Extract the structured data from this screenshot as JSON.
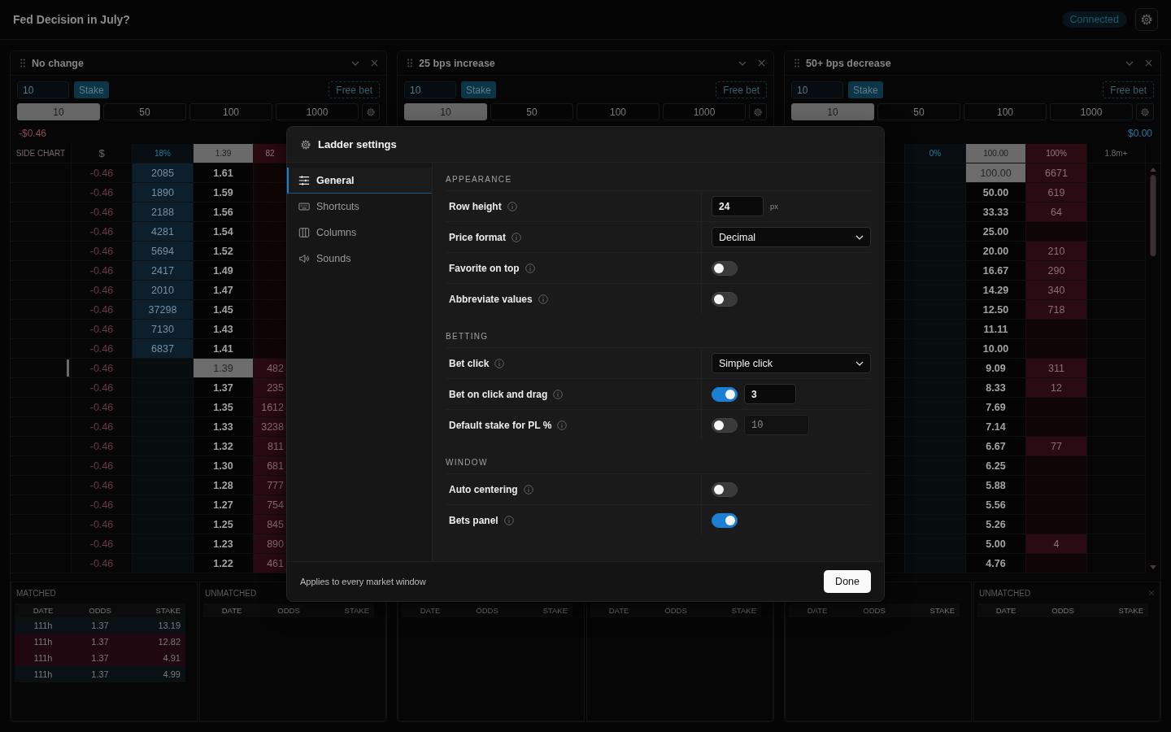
{
  "topbar": {
    "title": "Fed Decision in July?",
    "status": "Connected"
  },
  "ladders": [
    {
      "title": "No change",
      "stake_value": "10",
      "stake_button": "Stake",
      "free_bet_button": "Free bet",
      "presets": [
        {
          "label": "10",
          "selected": true
        },
        {
          "label": "50",
          "selected": false
        },
        {
          "label": "100",
          "selected": false
        },
        {
          "label": "1000",
          "selected": false
        }
      ],
      "pl": {
        "text": "-$0.46",
        "color": "#8a4a55"
      },
      "ladder_columns": [
        {
          "kind": "side",
          "label": "SIDE CHART"
        },
        {
          "kind": "pl",
          "label": "$"
        },
        {
          "kind": "back",
          "label": "18%"
        },
        {
          "kind": "price",
          "label": "1.39"
        },
        {
          "kind": "lay",
          "label": "82"
        }
      ],
      "rows": [
        {
          "pl": "-0.46",
          "back": "2085",
          "price": "1.61",
          "current": false
        },
        {
          "pl": "-0.46",
          "back": "1890",
          "price": "1.59",
          "current": false
        },
        {
          "pl": "-0.46",
          "back": "2188",
          "price": "1.56",
          "current": false
        },
        {
          "pl": "-0.46",
          "back": "4281",
          "price": "1.54",
          "current": false
        },
        {
          "pl": "-0.46",
          "back": "5694",
          "price": "1.52",
          "current": false
        },
        {
          "pl": "-0.46",
          "back": "2417",
          "price": "1.49",
          "current": false
        },
        {
          "pl": "-0.46",
          "back": "2010",
          "price": "1.47",
          "current": false
        },
        {
          "pl": "-0.46",
          "back": "37298",
          "price": "1.45",
          "current": false
        },
        {
          "pl": "-0.46",
          "back": "7130",
          "price": "1.43",
          "current": false
        },
        {
          "pl": "-0.46",
          "back": "6837",
          "price": "1.41",
          "current": false
        },
        {
          "pl": "-0.46",
          "price": "1.39",
          "lay": "482",
          "current": true
        },
        {
          "pl": "-0.46",
          "price": "1.37",
          "lay": "235",
          "current": false
        },
        {
          "pl": "-0.46",
          "price": "1.35",
          "lay": "1612",
          "current": false
        },
        {
          "pl": "-0.46",
          "price": "1.33",
          "lay": "3238",
          "current": false
        },
        {
          "pl": "-0.46",
          "price": "1.32",
          "lay": "811",
          "current": false
        },
        {
          "pl": "-0.46",
          "price": "1.30",
          "lay": "681",
          "current": false
        },
        {
          "pl": "-0.46",
          "price": "1.28",
          "lay": "777",
          "current": false
        },
        {
          "pl": "-0.46",
          "price": "1.27",
          "lay": "754",
          "current": false
        },
        {
          "pl": "-0.46",
          "price": "1.25",
          "lay": "845",
          "current": false
        },
        {
          "pl": "-0.46",
          "price": "1.23",
          "lay": "890",
          "current": false
        },
        {
          "pl": "-0.46",
          "price": "1.22",
          "lay": "461",
          "current": false
        }
      ],
      "bets": [
        {
          "label": "MATCHED",
          "columns": [
            "DATE",
            "ODDS",
            "STAKE"
          ],
          "rows": [
            {
              "color": "#0a1114",
              "cells": [
                "111h",
                "1.37",
                "13.19"
              ]
            },
            {
              "color": "#1f0810",
              "cells": [
                "111h",
                "1.37",
                "12.82"
              ]
            },
            {
              "color": "#1f0810",
              "cells": [
                "111h",
                "1.37",
                "4.91"
              ]
            },
            {
              "color": "#0a1114",
              "cells": [
                "111h",
                "1.37",
                "4.99"
              ]
            }
          ]
        },
        {
          "label": "UNMATCHED",
          "columns": [
            "DATE",
            "ODDS",
            "STAKE"
          ]
        }
      ]
    },
    {
      "title": "25 bps increase",
      "stake_value": "10",
      "stake_button": "Stake",
      "free_bet_button": "Free bet",
      "presets": [
        {
          "label": "10",
          "selected": true
        },
        {
          "label": "50",
          "selected": false
        },
        {
          "label": "100",
          "selected": false
        },
        {
          "label": "1000",
          "selected": false
        }
      ],
      "bets": [
        {
          "columns": [
            "DATE",
            "ODDS",
            "STAKE"
          ]
        },
        {
          "columns": [
            "DATE",
            "ODDS",
            "STAKE"
          ]
        }
      ]
    },
    {
      "title": "50+ bps decrease",
      "stake_value": "10",
      "stake_button": "Stake",
      "free_bet_button": "Free bet",
      "presets": [
        {
          "label": "10",
          "selected": true
        },
        {
          "label": "50",
          "selected": false
        },
        {
          "label": "100",
          "selected": false
        },
        {
          "label": "1000",
          "selected": false
        }
      ],
      "pl": {
        "text": "$0.00",
        "color": "#2a7aa0"
      },
      "ladder_columns": [
        {
          "kind": "pl"
        },
        {
          "kind": "back",
          "label": "0%"
        },
        {
          "kind": "price",
          "label": "100.00"
        },
        {
          "kind": "lay",
          "label": "100%"
        },
        {
          "kind": "volume",
          "label": "1.8m+"
        }
      ],
      "rows": [
        {
          "price": "100.00",
          "lay": "6671",
          "current": true
        },
        {
          "price": "50.00",
          "lay": "619",
          "current": false
        },
        {
          "price": "33.33",
          "lay": "64",
          "current": false
        },
        {
          "price": "25.00",
          "current": false
        },
        {
          "price": "20.00",
          "lay": "210",
          "current": false
        },
        {
          "price": "16.67",
          "lay": "290",
          "current": false
        },
        {
          "price": "14.29",
          "lay": "340",
          "current": false
        },
        {
          "price": "12.50",
          "lay": "718",
          "current": false
        },
        {
          "price": "11.11",
          "current": false
        },
        {
          "price": "10.00",
          "current": false
        },
        {
          "price": "9.09",
          "lay": "311",
          "current": false
        },
        {
          "price": "8.33",
          "lay": "12",
          "current": false
        },
        {
          "price": "7.69",
          "current": false
        },
        {
          "price": "7.14",
          "current": false
        },
        {
          "price": "6.67",
          "lay": "77",
          "current": false
        },
        {
          "price": "6.25",
          "current": false
        },
        {
          "price": "5.88",
          "current": false
        },
        {
          "price": "5.56",
          "current": false
        },
        {
          "price": "5.26",
          "current": false
        },
        {
          "price": "5.00",
          "lay": "4",
          "current": false
        },
        {
          "price": "4.76",
          "current": false
        }
      ],
      "bets": [
        {
          "columns": [
            "DATE",
            "ODDS",
            "STAKE"
          ]
        },
        {
          "label": "UNMATCHED",
          "closable": true,
          "columns": [
            "DATE",
            "ODDS",
            "STAKE"
          ]
        }
      ]
    }
  ],
  "settings": {
    "title": "Ladder settings",
    "nav": [
      {
        "label": "General",
        "selected": true
      },
      {
        "label": "Shortcuts",
        "selected": false
      },
      {
        "label": "Columns",
        "selected": false
      },
      {
        "label": "Sounds",
        "selected": false
      }
    ],
    "sections": [
      {
        "title": "APPEARANCE",
        "rows": [
          {
            "kind": "number",
            "label": "Row height",
            "value": "24",
            "unit": "px"
          },
          {
            "kind": "select",
            "label": "Price format",
            "value": "Decimal"
          },
          {
            "kind": "toggle",
            "label": "Favorite on top",
            "on": false
          },
          {
            "kind": "toggle",
            "label": "Abbreviate values",
            "on": false
          }
        ]
      },
      {
        "title": "BETTING",
        "rows": [
          {
            "kind": "select",
            "label": "Bet click",
            "value": "Simple click"
          },
          {
            "kind": "toggle_number",
            "label": "Bet on click and drag",
            "on": true,
            "value": "3"
          },
          {
            "kind": "toggle_number",
            "label": "Default stake for PL %",
            "on": false,
            "value": "10"
          }
        ]
      },
      {
        "title": "WINDOW",
        "rows": [
          {
            "kind": "toggle",
            "label": "Auto centering",
            "on": false
          },
          {
            "kind": "toggle",
            "label": "Bets panel",
            "on": true
          }
        ]
      }
    ],
    "footer_note": "Applies to every market window",
    "done_button": "Done"
  }
}
